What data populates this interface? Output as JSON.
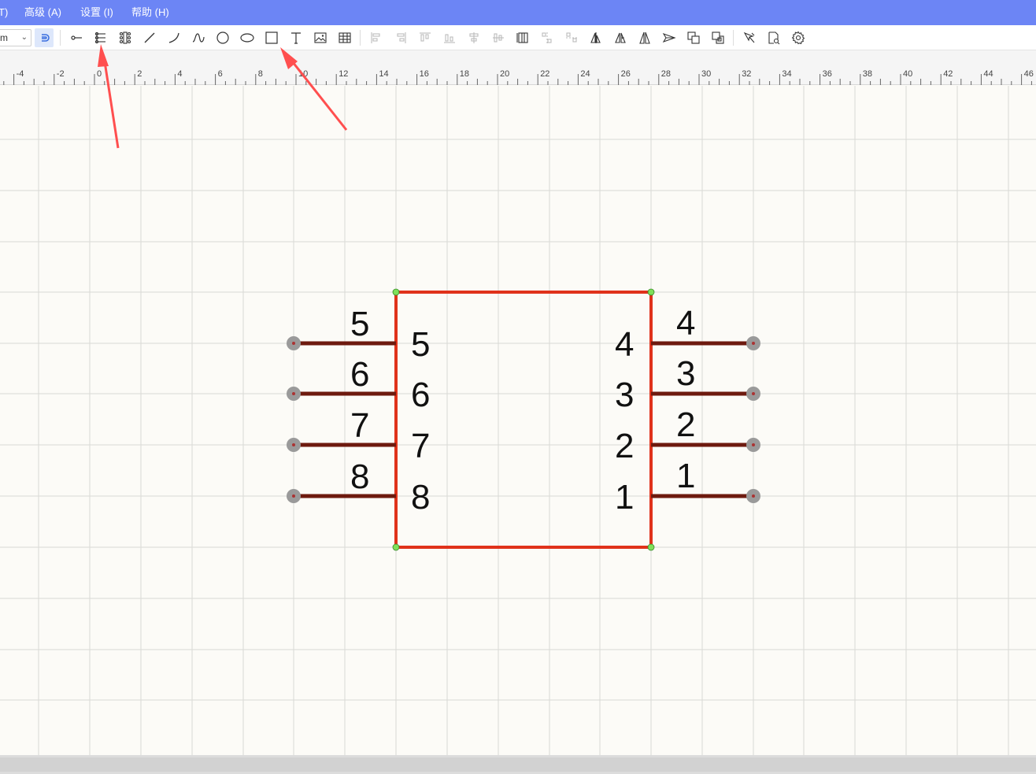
{
  "menubar": {
    "items": [
      {
        "label": "T)"
      },
      {
        "label": "高级 (A)"
      },
      {
        "label": "设置 (I)"
      },
      {
        "label": "帮助 (H)"
      }
    ]
  },
  "toolbar": {
    "unit_value": "m",
    "tools": [
      "snap-magnet-icon",
      "pin-icon",
      "pin-array-icon",
      "multi-pin-icon",
      "line-icon",
      "arc-icon",
      "bezier-icon",
      "circle-icon",
      "ellipse-icon",
      "rectangle-icon",
      "text-icon",
      "image-icon",
      "table-icon",
      "align-left-icon",
      "align-right-icon",
      "align-top-icon",
      "align-bottom-icon",
      "align-center-h-icon",
      "align-center-v-icon",
      "grid-align-icon",
      "distribute-h-icon",
      "distribute-v-icon",
      "flip-horizontal-icon",
      "flip-vertical-icon",
      "mirror-icon",
      "send-icon",
      "bring-forward-icon",
      "send-backward-icon",
      "pin-manager-icon",
      "symbol-check-icon",
      "settings-icon"
    ]
  },
  "ruler": {
    "labels": [
      "-4",
      "-2",
      "0",
      "2",
      "4",
      "6",
      "8",
      "10",
      "12",
      "14",
      "16",
      "18",
      "20",
      "22",
      "24",
      "26",
      "28",
      "30",
      "32",
      "34",
      "36",
      "38",
      "40",
      "42",
      "44",
      "46"
    ]
  },
  "symbol": {
    "left_pins": [
      {
        "number": "5",
        "name": "5"
      },
      {
        "number": "6",
        "name": "6"
      },
      {
        "number": "7",
        "name": "7"
      },
      {
        "number": "8",
        "name": "8"
      }
    ],
    "right_pins": [
      {
        "number": "4",
        "name": "4"
      },
      {
        "number": "3",
        "name": "3"
      },
      {
        "number": "2",
        "name": "2"
      },
      {
        "number": "1",
        "name": "1"
      }
    ],
    "colors": {
      "body": "#e0321b",
      "pin": "#6e1a0f",
      "pin_end": "#9a9a9a",
      "vertex": "#7ee05a",
      "annotation_arrow": "#ff4f4f"
    }
  }
}
